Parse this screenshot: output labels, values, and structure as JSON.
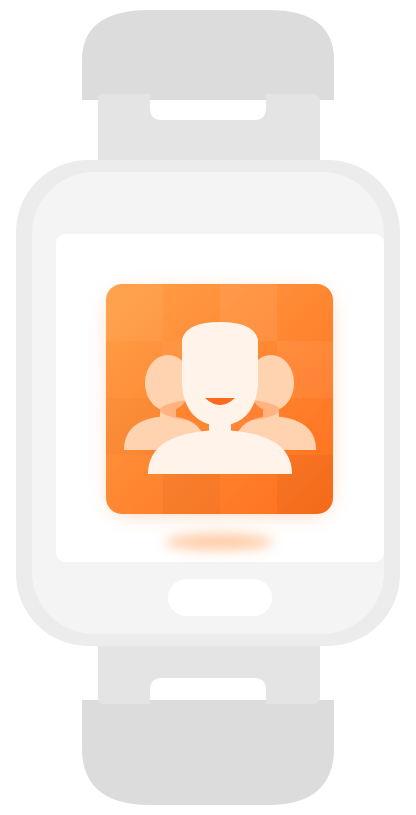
{
  "illustration": {
    "subject": "smartwatch",
    "screen_icon": "contacts-group-icon"
  },
  "colors": {
    "strap": "#dcdcdc",
    "strap_connector": "#e4e4e4",
    "case": "#ececec",
    "bezel": "#f4f4f4",
    "screen": "#ffffff",
    "button": "#ffffff",
    "tile_light": "#ffa048",
    "tile_dark": "#ff6e1c",
    "tile_glow": "#ffb27a",
    "person_back": "#ffd2b0",
    "person_front": "#fff3ea",
    "mouth": "#ff6a1f"
  }
}
